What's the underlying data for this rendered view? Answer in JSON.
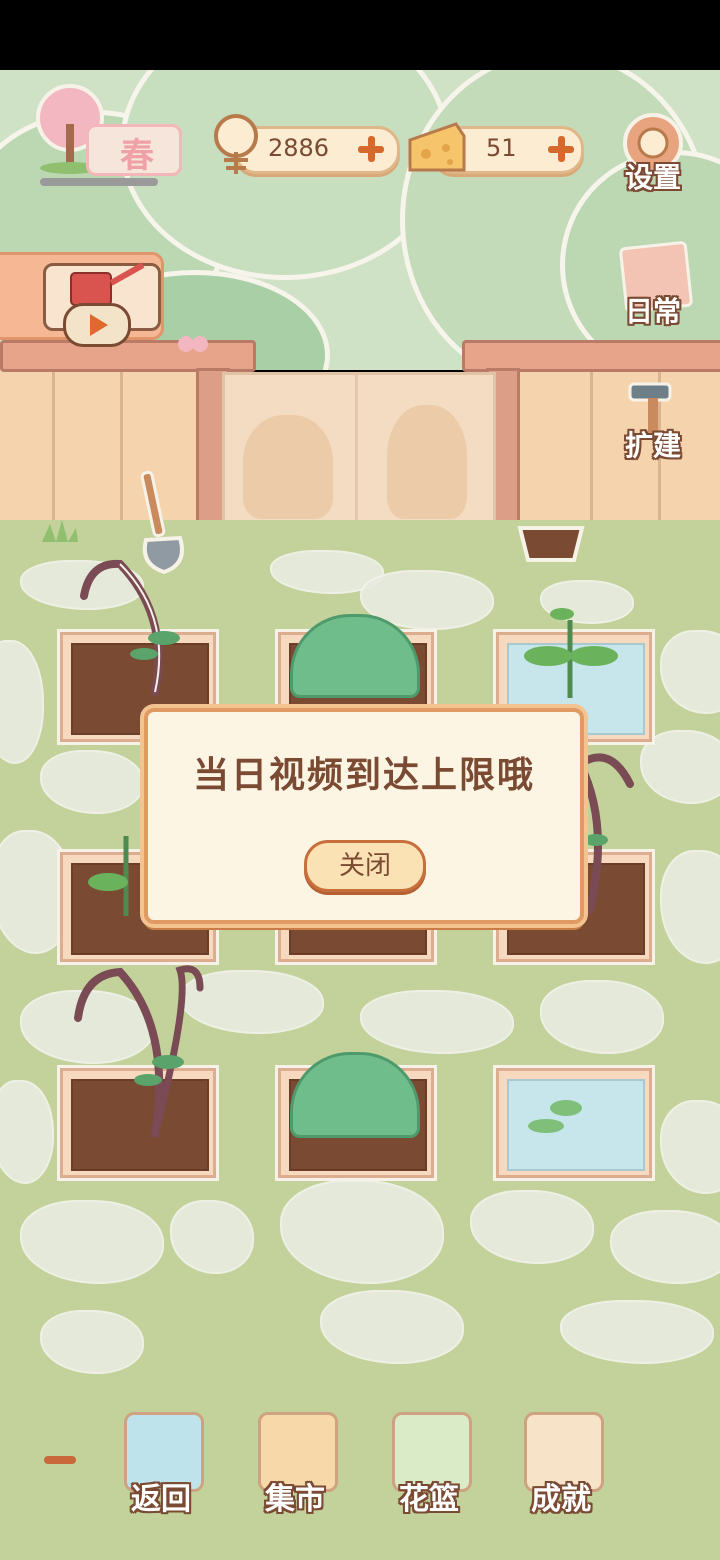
{
  "hud": {
    "season": "春",
    "fish_count": "2886",
    "cheese_count": "51"
  },
  "side_menu": {
    "settings": "设置",
    "daily": "日常",
    "expand": "扩建"
  },
  "dialog": {
    "message": "当日视频到达上限哦",
    "close_label": "关闭"
  },
  "bottom_nav": {
    "back": "返回",
    "market": "集市",
    "basket": "花篮",
    "achievement": "成就"
  },
  "colors": {
    "accent": "#d66a2c",
    "text_brown": "#7a4a33",
    "dialog_border": "#e29a63"
  },
  "icons": [
    "fishbone-icon",
    "cheese-icon",
    "plus-icon",
    "gear-icon",
    "tip-note-icon",
    "hammer-icon",
    "watering-can-icon",
    "play-icon",
    "shovel-icon",
    "pot-icon",
    "window-icon",
    "market-stall-icon",
    "flower-basket-icon",
    "trophy-icon"
  ]
}
